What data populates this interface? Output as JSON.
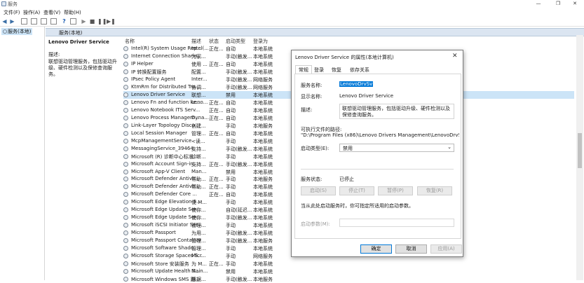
{
  "window": {
    "title": "服务"
  },
  "menu": [
    "文件(F)",
    "操作(A)",
    "查看(V)",
    "帮助(H)"
  ],
  "tree": {
    "root": "服务(本地)"
  },
  "main": {
    "header": "服务(本地)",
    "selected_name": "Lenovo Driver Service",
    "desc_label": "描述:",
    "desc_text": "联想驱动管理服务，包括驱动升级、硬件检测以及保修查询服务。"
  },
  "columns": {
    "name": "名称",
    "desc": "描述",
    "status": "状态",
    "startup": "启动类型",
    "logon": "登录为"
  },
  "services": [
    {
      "name": "Intel(R) System Usage Rep...",
      "desc": "Intel(...",
      "status": "正在...",
      "startup": "自动",
      "logon": "本地系统"
    },
    {
      "name": "Internet Connection Sharin...",
      "desc": "为家...",
      "status": "",
      "startup": "手动(触发...",
      "logon": "本地系统"
    },
    {
      "name": "IP Helper",
      "desc": "使用 ...",
      "status": "正在...",
      "startup": "自动",
      "logon": "本地系统"
    },
    {
      "name": "IP 转换配置服务",
      "desc": "配置...",
      "status": "",
      "startup": "手动(触发...",
      "logon": "本地系统"
    },
    {
      "name": "IPsec Policy Agent",
      "desc": "Inter...",
      "status": "",
      "startup": "手动(触发...",
      "logon": "网络服务"
    },
    {
      "name": "KtmRm for Distributed Tra...",
      "desc": "协调...",
      "status": "",
      "startup": "手动(触发...",
      "logon": "网络服务"
    },
    {
      "name": "Lenovo Driver Service",
      "desc": "联想...",
      "status": "",
      "startup": "禁用",
      "logon": "本地系统"
    },
    {
      "name": "Lenovo Fn and function ke...",
      "desc": "Leno...",
      "status": "正在...",
      "startup": "自动",
      "logon": "本地系统"
    },
    {
      "name": "Lenovo Notebook ITS Serv...",
      "desc": "",
      "status": "正在...",
      "startup": "自动",
      "logon": "本地系统"
    },
    {
      "name": "Lenovo Process Managem...",
      "desc": "Dyna...",
      "status": "正在...",
      "startup": "自动",
      "logon": "本地系统"
    },
    {
      "name": "Link-Layer Topology Disco...",
      "desc": "创建...",
      "status": "",
      "startup": "手动",
      "logon": "本地服务"
    },
    {
      "name": "Local Session Manager",
      "desc": "管理...",
      "status": "正在...",
      "startup": "自动",
      "logon": "本地系统"
    },
    {
      "name": "McpManagementService",
      "desc": "<读...",
      "status": "",
      "startup": "手动",
      "logon": "本地系统"
    },
    {
      "name": "MessagingService_39464",
      "desc": "支持...",
      "status": "",
      "startup": "手动(触发...",
      "logon": "本地系统"
    },
    {
      "name": "Microsoft (R) 诊断中心标准...",
      "desc": "诊断...",
      "status": "",
      "startup": "手动",
      "logon": "本地系统"
    },
    {
      "name": "Microsoft Account Sign-in ...",
      "desc": "支持...",
      "status": "正在...",
      "startup": "手动(触发...",
      "logon": "本地系统"
    },
    {
      "name": "Microsoft App-V Client",
      "desc": "Man...",
      "status": "",
      "startup": "禁用",
      "logon": "本地系统"
    },
    {
      "name": "Microsoft Defender Antivir...",
      "desc": "帮助...",
      "status": "正在...",
      "startup": "手动",
      "logon": "本地服务"
    },
    {
      "name": "Microsoft Defender Antivir...",
      "desc": "帮助...",
      "status": "正在...",
      "startup": "手动",
      "logon": "本地系统"
    },
    {
      "name": "Microsoft Defender Core ...",
      "desc": "",
      "status": "正在...",
      "startup": "自动",
      "logon": "本地系统"
    },
    {
      "name": "Microsoft Edge Elevation S...",
      "desc": "使 M...",
      "status": "",
      "startup": "手动",
      "logon": "本地系统"
    },
    {
      "name": "Microsoft Edge Update Ser...",
      "desc": "使你...",
      "status": "",
      "startup": "自动(延迟...",
      "logon": "本地系统"
    },
    {
      "name": "Microsoft Edge Update Ser...",
      "desc": "使你...",
      "status": "",
      "startup": "手动(触发...",
      "logon": "本地系统"
    },
    {
      "name": "Microsoft iSCSI Initiator Ser...",
      "desc": "管理...",
      "status": "",
      "startup": "手动",
      "logon": "本地系统"
    },
    {
      "name": "Microsoft Passport",
      "desc": "为用...",
      "status": "",
      "startup": "手动(触发...",
      "logon": "本地系统"
    },
    {
      "name": "Microsoft Passport Container",
      "desc": "管理...",
      "status": "",
      "startup": "手动(触发...",
      "logon": "本地服务"
    },
    {
      "name": "Microsoft Software Shado...",
      "desc": "管理...",
      "status": "",
      "startup": "手动",
      "logon": "本地系统"
    },
    {
      "name": "Microsoft Storage Spaces S...",
      "desc": "Micr...",
      "status": "",
      "startup": "手动",
      "logon": "网络服务"
    },
    {
      "name": "Microsoft Store 安装服务",
      "desc": "为 M...",
      "status": "正在...",
      "startup": "手动",
      "logon": "本地系统"
    },
    {
      "name": "Microsoft Update Health S...",
      "desc": "Main...",
      "status": "",
      "startup": "禁用",
      "logon": "本地系统"
    },
    {
      "name": "Microsoft Windows SMS 路...",
      "desc": "根据...",
      "status": "",
      "startup": "手动(触发...",
      "logon": "本地服务"
    }
  ],
  "dialog": {
    "title": "Lenovo Driver Service 的属性(本地计算机)",
    "tabs": [
      "常规",
      "登录",
      "恢复",
      "依存关系"
    ],
    "service_name_label": "服务名称:",
    "service_name": "LenovoDrvSv",
    "display_name_label": "显示名称:",
    "display_name": "Lenovo Driver Service",
    "description_label": "描述:",
    "description": "联想驱动管理服务，包括驱动升级、硬件检测以及保修查询服务。",
    "path_label": "可执行文件的路径:",
    "path": "\"D:\\Program Files (x86)\\Lenovo Drivers Management\\LenovoDrvSv.exe\"",
    "startup_label": "启动类型(E):",
    "startup_value": "禁用",
    "status_label": "服务状态:",
    "status_value": "已停止",
    "buttons": {
      "start": "启动(S)",
      "stop": "停止(T)",
      "pause": "暂停(P)",
      "resume": "恢复(R)"
    },
    "hint": "当从此处启动服务时，你可指定所适用的启动参数。",
    "params_label": "启动参数(M):",
    "ok": "确定",
    "cancel": "取消",
    "apply": "应用(A)"
  }
}
